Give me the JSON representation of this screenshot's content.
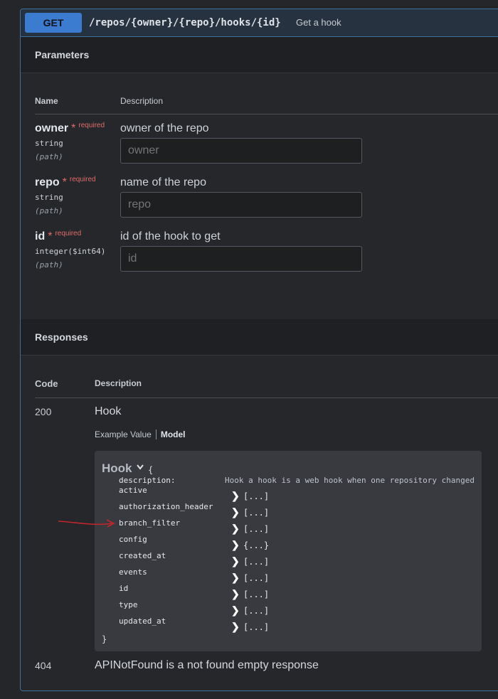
{
  "operation": {
    "method": "GET",
    "path": "/repos/{owner}/{repo}/hooks/{id}",
    "summary": "Get a hook"
  },
  "parameters": {
    "section_title": "Parameters",
    "col_name": "Name",
    "col_description": "Description",
    "items": [
      {
        "name": "owner",
        "star": "*",
        "required": "required",
        "type": "string",
        "in": "(path)",
        "description": "owner of the repo",
        "placeholder": "owner"
      },
      {
        "name": "repo",
        "star": "*",
        "required": "required",
        "type": "string",
        "in": "(path)",
        "description": "name of the repo",
        "placeholder": "repo"
      },
      {
        "name": "id",
        "star": "*",
        "required": "required",
        "type": "integer($int64)",
        "in": "(path)",
        "description": "id of the hook to get",
        "placeholder": "id"
      }
    ]
  },
  "responses": {
    "section_title": "Responses",
    "col_code": "Code",
    "col_description": "Description",
    "items": [
      {
        "code": "200",
        "description": "Hook"
      },
      {
        "code": "404",
        "description": "APINotFound is a not found empty response"
      }
    ],
    "tabs": {
      "example": "Example Value",
      "model": "Model"
    }
  },
  "model": {
    "title": "Hook",
    "open_brace": "{",
    "close_brace": "}",
    "description_key": "description:",
    "description_value": "Hook a hook is a web hook when one repository changed",
    "properties": [
      {
        "name": "active",
        "type": "[...]"
      },
      {
        "name": "authorization_header",
        "type": "[...]"
      },
      {
        "name": "branch_filter",
        "type": "[...]"
      },
      {
        "name": "config",
        "type": "{...}"
      },
      {
        "name": "created_at",
        "type": "[...]"
      },
      {
        "name": "events",
        "type": "[...]"
      },
      {
        "name": "id",
        "type": "[...]"
      },
      {
        "name": "type",
        "type": "[...]"
      },
      {
        "name": "updated_at",
        "type": "[...]"
      }
    ]
  },
  "colors": {
    "method": "#3b7bd0",
    "border": "#3d6f9c",
    "required": "#e06b6b",
    "annotation": "#c0262c"
  }
}
